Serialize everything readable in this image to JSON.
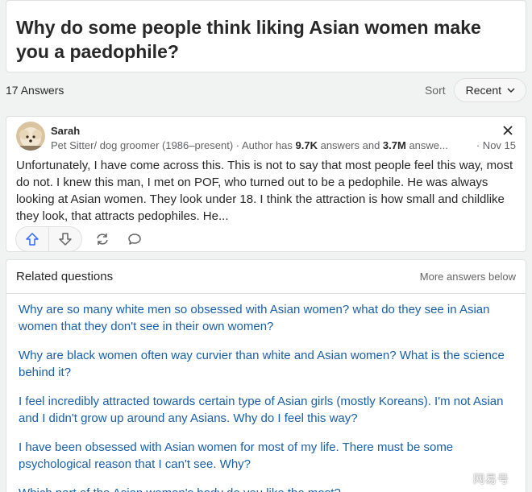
{
  "question": {
    "title": "Why do some people think liking Asian women make you a paedophile?"
  },
  "answers_bar": {
    "count_label": "17 Answers",
    "sort_label": "Sort",
    "sort_value": "Recent"
  },
  "answer": {
    "author_name": "Sarah",
    "credential_prefix": "Pet Sitter/ dog groomer (1986–present) · Author has ",
    "answers_count": "9.7K",
    "answers_word": " answers and ",
    "views_count": "3.7M",
    "views_word": " answe...",
    "date": "· Nov 15",
    "text": "Unfortunately, I have come across this. This is not to say that most people feel this way, most do not. I knew this man, I met on POF, who turned out to be a pedophile. He was always looking at Asian women. They look under 18. I think the attraction is how small and childlike they look, that attracts pedophiles. He..."
  },
  "related": {
    "title": "Related questions",
    "note": "More answers below",
    "items": [
      "Why are so many white men so obsessed with Asian women? what do they see in Asian women that they don't see in their own women?",
      "Why are black women often way curvier than white and Asian women? What is the science behind it?",
      "I feel incredibly attracted towards certain type of Asian girls (mostly Koreans). I'm not Asian and I didn't grow up around any Asians. Why do I feel this way?",
      "I have been obsessed with Asian women for most of my life. There must be some psychological reason that I can't see. Why?",
      "Which part of the Asian woman's body do you like the most?"
    ]
  },
  "watermark": "网易号",
  "colors": {
    "link": "#195faa",
    "text": "#282829",
    "muted": "#636466",
    "border": "#dee0e1",
    "background": "#f1f2f2"
  },
  "icons": [
    "close-icon",
    "chevron-down-icon",
    "upvote-icon",
    "downvote-icon",
    "share-icon",
    "comment-icon"
  ]
}
